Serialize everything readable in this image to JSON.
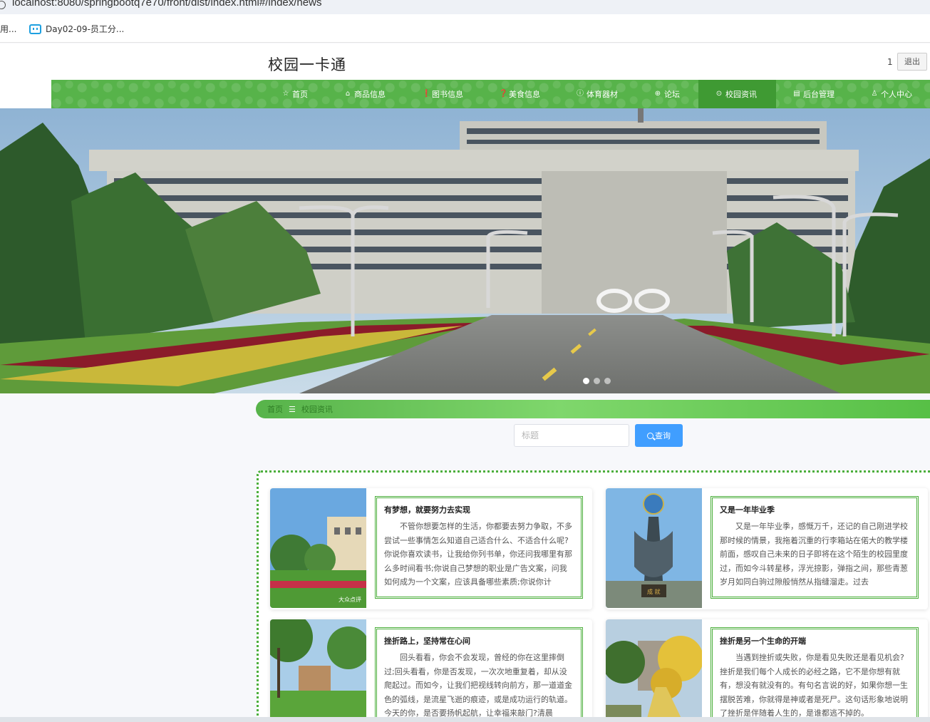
{
  "browser": {
    "url": "localhost:8080/springbootq7e70/front/dist/index.html#/index/news",
    "bookmark_truncated": "用...",
    "bookmark_bili": "Day02-09-员工分..."
  },
  "header": {
    "title": "校园一卡通",
    "user_count": "1",
    "logout_label": "退出"
  },
  "nav": {
    "items": [
      {
        "label": "首页",
        "icon": "star-icon"
      },
      {
        "label": "商品信息",
        "icon": "bag-icon"
      },
      {
        "label": "图书信息",
        "icon": "info-icon"
      },
      {
        "label": "美食信息",
        "icon": "question-icon"
      },
      {
        "label": "体育器材",
        "icon": "info-icon"
      },
      {
        "label": "论坛",
        "icon": "globe-icon"
      },
      {
        "label": "校园资讯",
        "icon": "clock-icon"
      },
      {
        "label": "后台管理",
        "icon": "clipboard-icon"
      },
      {
        "label": "个人中心",
        "icon": "user-icon"
      }
    ],
    "active_index": 6,
    "bg_color": "#57b34a",
    "active_color": "#3f9a33"
  },
  "banner": {
    "carousel_total": 3,
    "carousel_active": 1
  },
  "breadcrumb": {
    "home": "首页",
    "current": "校园资讯"
  },
  "search": {
    "placeholder": "标题",
    "button_label": "查询",
    "button_color": "#409eff"
  },
  "news": [
    {
      "title": "有梦想，就要努力去实现",
      "summary": "不管你想要怎样的生活，你都要去努力争取，不多尝试一些事情怎么知道自己适合什么、不适合什么呢?你说你喜欢读书，让我给你列书单，你还问我哪里有那么多时间看书;你说自己梦想的职业是广告文案，问我如何成为一个文案，应该具备哪些素质;你说你计",
      "image_watermark": "大众点评"
    },
    {
      "title": "又是一年毕业季",
      "summary": "又是一年毕业季，感慨万千，还记的自己刚进学校那时候的情景，我拖着沉重的行李箱站在偌大的教学楼前面，感叹自己未来的日子即将在这个陌生的校园里度过，而如今斗转星移，浮光掠影，弹指之间，那些青葱岁月如同白驹过隙般悄然从指缝溜走。过去"
    },
    {
      "title": "挫折路上，坚持常在心间",
      "summary": "回头看看，你会不会发现，曾经的你在这里摔倒过;回头看看，你是否发现，一次次地重复着，却从没爬起过。而如今，让我们把视线转向前方，那一道道金色的弧线，是流星飞逝的痕迹，或是成功运行的轨道。今天的你，是否要扬帆起航，让幸福来敲门?清晨"
    },
    {
      "title": "挫折是另一个生命的开端",
      "summary": "当遇到挫折或失败，你是看见失败还是看见机会?挫折是我们每个人成长的必经之路，它不是你想有就有，想没有就没有的。有句名言说的好，如果你想一生摆脱苦难，你就得是神或者是死尸。这句话形象地说明了挫折是伴随着人生的，是谁都逃不掉的。"
    }
  ]
}
